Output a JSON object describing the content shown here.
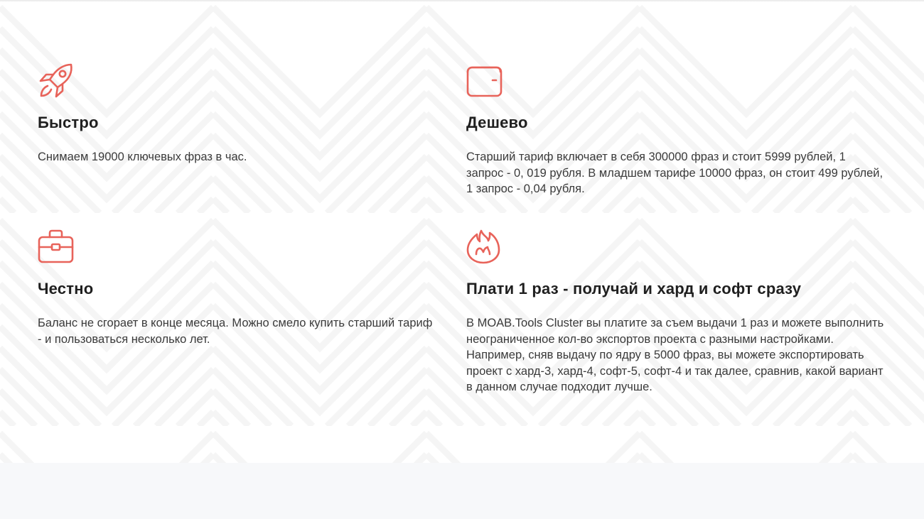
{
  "colors": {
    "accent": "#e8635a",
    "background": "#ffffff",
    "pattern": "#ededed",
    "footer_strip": "#f7f8fa",
    "heading": "#1f1f1f",
    "text": "#3a3a3a"
  },
  "features": [
    {
      "icon": "rocket-icon",
      "title": "Быстро",
      "text": "Снимаем 19000 ключевых фраз в час."
    },
    {
      "icon": "wallet-icon",
      "title": "Дешево",
      "text": "Старший тариф включает в себя 300000 фраз и стоит 5999 рублей, 1 запрос - 0, 019 рубля. В младшем тарифе 10000 фраз, он стоит 499 рублей, 1 запрос - 0,04 рубля."
    },
    {
      "icon": "briefcase-icon",
      "title": "Честно",
      "text": "Баланс не сгорает в конце месяца. Можно смело купить старший тариф - и пользоваться несколько лет."
    },
    {
      "icon": "fire-icon",
      "title": "Плати 1 раз - получай и хард и софт сразу",
      "text": "В MOAB.Tools Cluster вы платите за съем выдачи 1 раз и можете выполнить неограниченное кол-во экспортов проекта с разными настройками. Например, сняв выдачу по ядру в 5000 фраз, вы можете экспортировать проект с хард-3, хард-4, софт-5, софт-4 и так далее, сравнив, какой вариант в данном случае подходит лучше."
    }
  ]
}
